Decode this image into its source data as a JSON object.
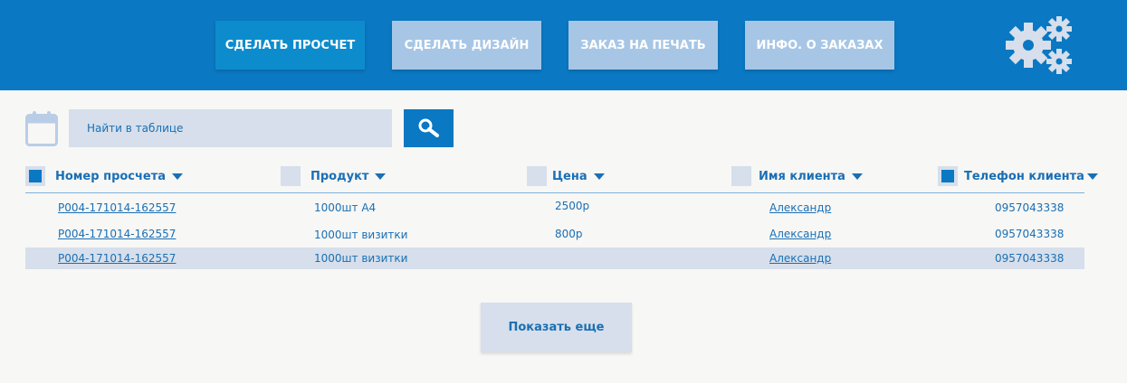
{
  "nav": {
    "tabs": [
      {
        "label": "СДЕЛАТЬ ПРОСЧЕТ",
        "active": true
      },
      {
        "label": "СДЕЛАТЬ ДИЗАЙН",
        "active": false
      },
      {
        "label": "ЗАКАЗ НА ПЕЧАТЬ",
        "active": false
      },
      {
        "label": "ИНФО. О ЗАКАЗАХ",
        "active": false
      }
    ],
    "settings_icon": "gears-icon"
  },
  "search": {
    "placeholder": "Найти в таблице",
    "calendar_icon": "calendar-icon",
    "search_icon": "search-icon"
  },
  "table": {
    "columns": [
      {
        "label": "Номер просчета",
        "checked": true
      },
      {
        "label": "Продукт",
        "checked": false
      },
      {
        "label": "Цена",
        "checked": false
      },
      {
        "label": "Имя клиента",
        "checked": false
      },
      {
        "label": "Телефон клиента",
        "checked": true
      }
    ],
    "rows": [
      {
        "number": "P004-171014-162557",
        "product": "1000шт А4",
        "price": "2500р",
        "client": "Александр",
        "phone": "0957043338",
        "selected": false
      },
      {
        "number": "P004-171014-162557",
        "product": "1000шт визитки",
        "price": "800р",
        "client": "Александр",
        "phone": "0957043338",
        "selected": false
      },
      {
        "number": "P004-171014-162557",
        "product": "1000шт визитки",
        "price": "",
        "client": "Александр",
        "phone": "0957043338",
        "selected": true
      }
    ]
  },
  "show_more": {
    "label": "Показать еще"
  },
  "colors": {
    "accent": "#0a78c2",
    "inactive_tab": "#a7c6e6",
    "surface": "#d6dfeb",
    "text": "#1a6fb5"
  }
}
